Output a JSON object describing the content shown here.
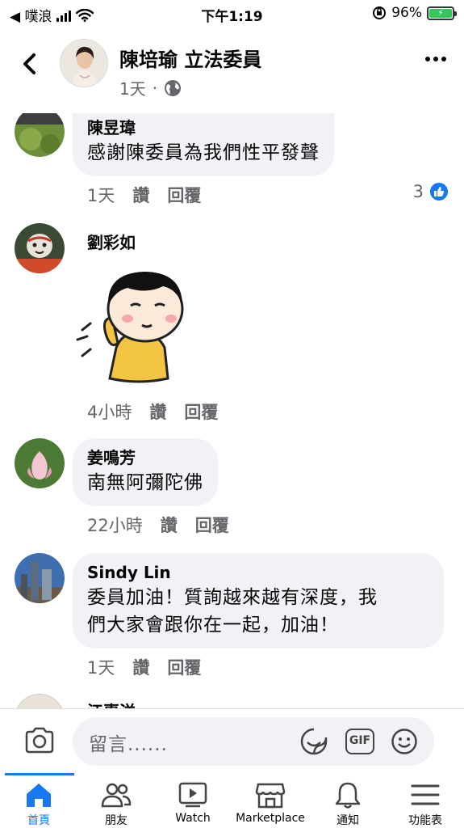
{
  "status_bar": {
    "carrier": "◀ 噗浪",
    "time": "下午1:19",
    "battery": "96%"
  },
  "post_header": {
    "author": "陳培瑜 立法委員",
    "time": "1天",
    "separator": "·"
  },
  "comments": [
    {
      "name": "陳昱瑋",
      "text": "感謝陳委員為我們性平發聲",
      "time": "1天",
      "like_label": "讚",
      "reply_label": "回覆",
      "like_count": "3"
    },
    {
      "name": "劉彩如",
      "time": "4小時",
      "like_label": "讚",
      "reply_label": "回覆"
    },
    {
      "name": "姜鳴芳",
      "text": "南無阿彌陀佛",
      "time": "22小時",
      "like_label": "讚",
      "reply_label": "回覆"
    },
    {
      "name": "Sindy Lin",
      "text_line1": "委員加油！質詢越來越有深度，我",
      "text_line2": "們大家會跟你在一起，加油！",
      "time": "1天",
      "like_label": "讚",
      "reply_label": "回覆"
    },
    {
      "name": "江惠洋"
    }
  ],
  "comment_box": {
    "placeholder": "留言......",
    "gif_label": "GIF"
  },
  "tabbar": {
    "items": [
      {
        "label": "首頁",
        "icon": "home-icon"
      },
      {
        "label": "朋友",
        "icon": "friends-icon"
      },
      {
        "label": "Watch",
        "icon": "watch-icon"
      },
      {
        "label": "Marketplace",
        "icon": "marketplace-icon"
      },
      {
        "label": "通知",
        "icon": "bell-icon"
      },
      {
        "label": "功能表",
        "icon": "menu-icon"
      }
    ],
    "active_color": "#1877f2"
  }
}
